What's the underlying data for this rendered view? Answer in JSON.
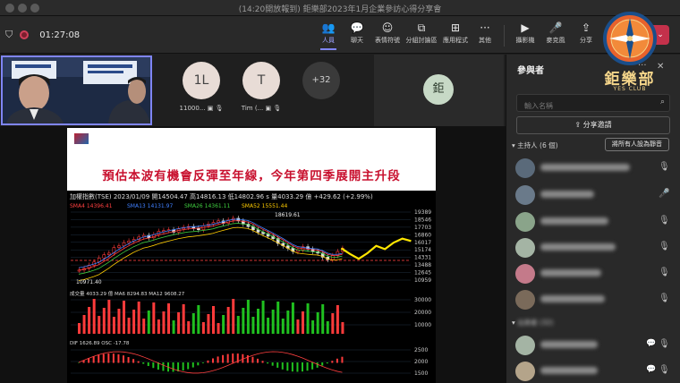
{
  "window": {
    "title": "(14:20開放報到) 鉅樂部2023年1月企業參訪心得分享會"
  },
  "toolbar": {
    "timer": "01:27:08",
    "buttons": [
      {
        "label": "人員",
        "icon": "people-icon",
        "glyph": "👥"
      },
      {
        "label": "聊天",
        "icon": "chat-icon",
        "glyph": "💬"
      },
      {
        "label": "表情符號",
        "icon": "emoji-icon",
        "glyph": "☺"
      },
      {
        "label": "分組討論區",
        "icon": "breakout-icon",
        "glyph": "⧉"
      },
      {
        "label": "應用程式",
        "icon": "apps-icon",
        "glyph": "⊞"
      },
      {
        "label": "其他",
        "icon": "more-icon",
        "glyph": "···"
      },
      {
        "label": "攝影機",
        "icon": "camera-icon",
        "glyph": "▶"
      },
      {
        "label": "麥克風",
        "icon": "mic-icon",
        "glyph": "🎤"
      },
      {
        "label": "分享",
        "icon": "share-icon",
        "glyph": "⇪"
      }
    ]
  },
  "strip": {
    "tiles": [
      {
        "initials": "1L",
        "name": "11000..."
      },
      {
        "initials": "T",
        "name": "Tim (..."
      }
    ],
    "more": "+32",
    "presenter_initial": "鉅"
  },
  "slide": {
    "title": "預估本波有機會反彈至年線，今年第四季展開主升段"
  },
  "chart_data": {
    "type": "candlestick",
    "title": "加權指數(TSE)",
    "header": "2023/01/09  開14504.47 高14816.13 低14802.96 s 量4033.29 億 +429.62 (+2.99%)",
    "legend": [
      {
        "name": "SMA4 14396.41",
        "color": "#ff4040"
      },
      {
        "name": "SMA13 14131.97",
        "color": "#4080ff"
      },
      {
        "name": "SMA26 14361.11",
        "color": "#40d040"
      },
      {
        "name": "SMA52 15551.44",
        "color": "#ffcc00"
      }
    ],
    "y_ticks": [
      "19389",
      "18546",
      "17703",
      "16860",
      "16017",
      "15174",
      "14331",
      "13488",
      "12645",
      "10959"
    ],
    "annotations": {
      "high": "18619.61",
      "low": "10971.40"
    },
    "volume_legend": "成交量 4033.29 億  MA6 8294.83  MA12 9608.27",
    "volume_ticks": [
      "30000",
      "20000",
      "10000"
    ],
    "macd_legend": "DIF 1626.89  OSC -17.78",
    "macd_ticks": [
      "2500",
      "2000",
      "1500"
    ],
    "prices": [
      12200,
      12400,
      12800,
      13200,
      13700,
      14100,
      14300,
      15000,
      15200,
      15600,
      15800,
      16000,
      16300,
      16500,
      16200,
      16600,
      17000,
      17100,
      17200,
      16900,
      17300,
      17500,
      17600,
      17400,
      17200,
      17700,
      17900,
      18100,
      18300,
      18000,
      18400,
      18619,
      18300,
      17900,
      17600,
      17200,
      16900,
      16700,
      16400,
      16100,
      15500,
      15200,
      14900,
      14500,
      14700,
      15100,
      14800,
      14500,
      14300,
      13800,
      13500,
      14000,
      14500,
      14900
    ],
    "forecast": [
      14900,
      14200,
      13600,
      14300,
      15200,
      14800,
      15600,
      16100,
      15800
    ]
  },
  "panel": {
    "title": "參與者",
    "search_placeholder": "輸入名稱",
    "share_invite": "分享邀請",
    "host_section": "主持人 (6 個)",
    "mute_all": "將所有人設為靜音",
    "attendee_section": "出席者 (32)"
  },
  "club": {
    "name": "鉅樂部",
    "sub": "YES CLUB",
    "ring": "SINCE 2019"
  }
}
